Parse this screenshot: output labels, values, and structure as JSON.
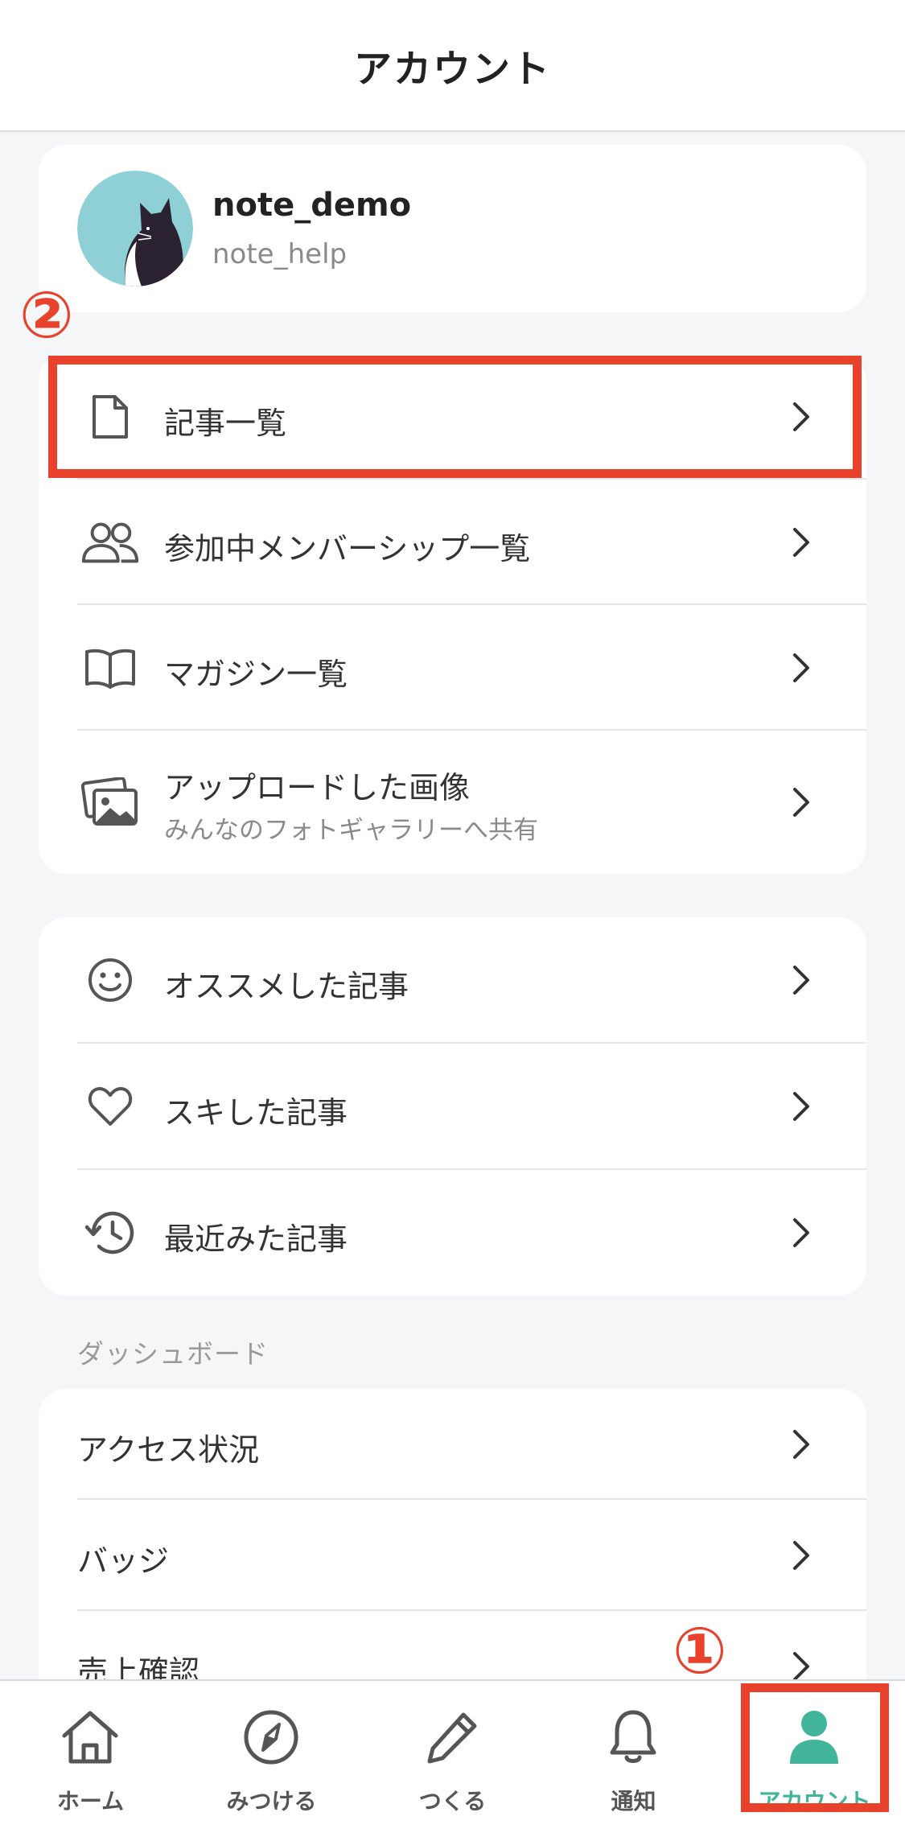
{
  "header": {
    "title": "アカウント"
  },
  "profile": {
    "name": "note_demo",
    "id": "note_help",
    "avatar_icon": "cat-avatar-icon"
  },
  "menu1": [
    {
      "icon": "document-icon",
      "label": "記事一覧"
    },
    {
      "icon": "members-icon",
      "label": "参加中メンバーシップ一覧"
    },
    {
      "icon": "book-icon",
      "label": "マガジン一覧"
    },
    {
      "icon": "images-icon",
      "label": "アップロードした画像",
      "sublabel": "みんなのフォトギャラリーへ共有"
    }
  ],
  "menu2": [
    {
      "icon": "smile-icon",
      "label": "オススメした記事"
    },
    {
      "icon": "heart-icon",
      "label": "スキした記事"
    },
    {
      "icon": "history-icon",
      "label": "最近みた記事"
    }
  ],
  "dashboard": {
    "section_label": "ダッシュボード",
    "items": [
      {
        "label": "アクセス状況"
      },
      {
        "label": "バッジ"
      },
      {
        "label": "売上確認"
      }
    ]
  },
  "annotations": [
    {
      "number": "①",
      "target": "tab-account"
    },
    {
      "number": "②",
      "target": "menu-articles"
    }
  ],
  "tabbar": [
    {
      "icon": "home-icon",
      "label": "ホーム",
      "active": false
    },
    {
      "icon": "compass-icon",
      "label": "みつける",
      "active": false
    },
    {
      "icon": "pencil-icon",
      "label": "つくる",
      "active": false
    },
    {
      "icon": "bell-icon",
      "label": "通知",
      "active": false
    },
    {
      "icon": "person-icon",
      "label": "アカウント",
      "active": true
    }
  ],
  "colors": {
    "accent": "#41b49a",
    "annotation": "#e8412c",
    "avatar_bg": "#8ed0d6"
  }
}
